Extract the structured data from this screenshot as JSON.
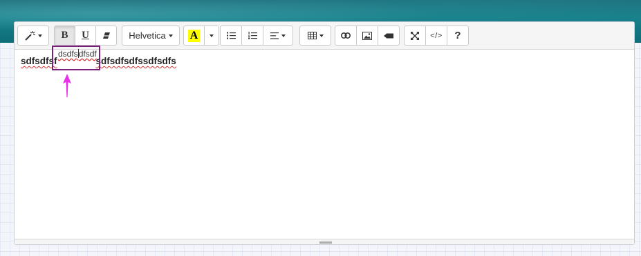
{
  "toolbar": {
    "style_icon": "magic-wand-icon",
    "bold_label": "B",
    "underline_label": "U",
    "eraser_icon": "eraser-icon",
    "font_name": "Helvetica",
    "color_label": "A",
    "color_swatch": "#ffff00",
    "unordered_list_icon": "unordered-list-icon",
    "ordered_list_icon": "ordered-list-icon",
    "paragraph_icon": "align-left-icon",
    "table_icon": "table-icon",
    "link_icon": "link-icon",
    "picture_icon": "picture-icon",
    "video_icon": "video-icon",
    "fullscreen_icon": "fullscreen-icon",
    "codeview_label": "</>",
    "help_label": "?"
  },
  "content": {
    "text_before": "sdfsdfsf",
    "text_after": "sdfsdfsdfssdfsdfs",
    "inserted_before_cursor": "dsdfs",
    "inserted_after_cursor": "dfsdf"
  },
  "annotation": {
    "box_color": "#7a1f7a",
    "arrow_color": "#e830e8"
  }
}
